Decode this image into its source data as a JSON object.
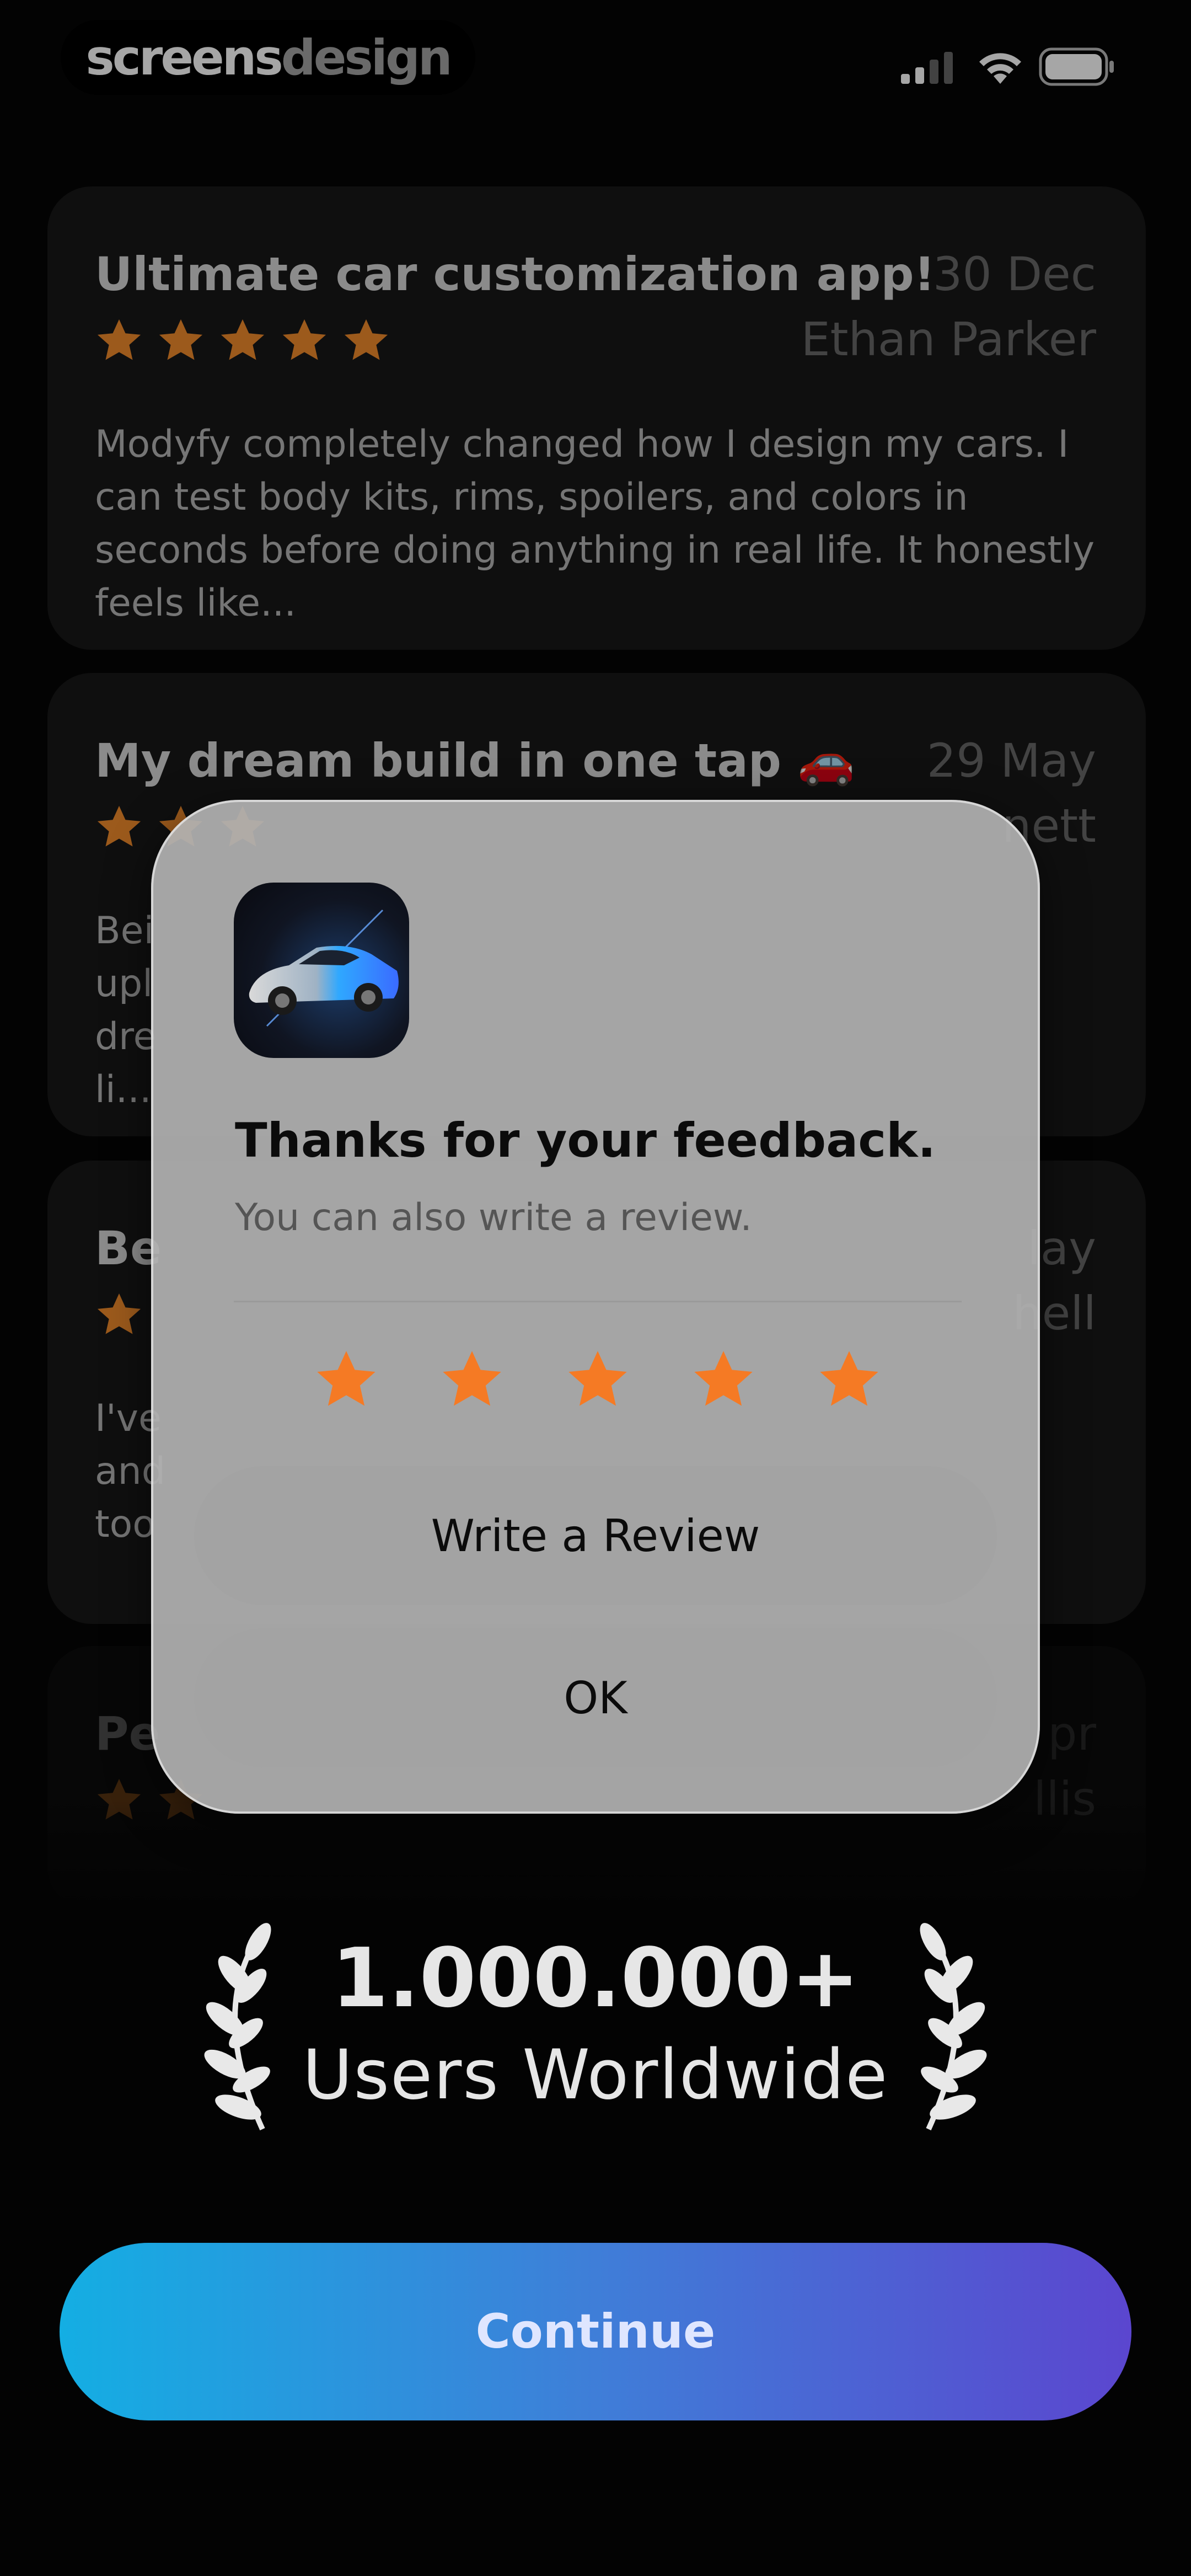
{
  "status_bar": {
    "brand_part1": "screens",
    "brand_part2": "design"
  },
  "reviews": [
    {
      "title": "Ultimate car customization app!",
      "date": "30 Dec",
      "author": "Ethan Parker",
      "rating": 5,
      "body": "Modyfy completely changed how I design my cars. I can test body kits, rims, spoilers, and colors in seconds before doing anything in real life. It honestly feels like..."
    },
    {
      "title": "My dream build in one tap 🚗",
      "date": "29 May",
      "author": "nett",
      "rating": 5,
      "body": "Bei upl dre li..."
    },
    {
      "title": "Be",
      "date": "lay",
      "author": "hell",
      "rating": 5,
      "body": "I've and too"
    },
    {
      "title": "Pe",
      "date": "pr",
      "author": "llis",
      "rating": 5,
      "body": ""
    }
  ],
  "dialog": {
    "title": "Thanks for your feedback.",
    "subtitle": "You can also write a review.",
    "rating": 5,
    "write_review_label": "Write a Review",
    "ok_label": "OK"
  },
  "social_proof": {
    "count": "1.000.000+",
    "label": "Users Worldwide"
  },
  "continue_label": "Continue",
  "colors": {
    "star": "#f08a2b",
    "continue_start": "#14aee3",
    "continue_end": "#5b46cf"
  }
}
